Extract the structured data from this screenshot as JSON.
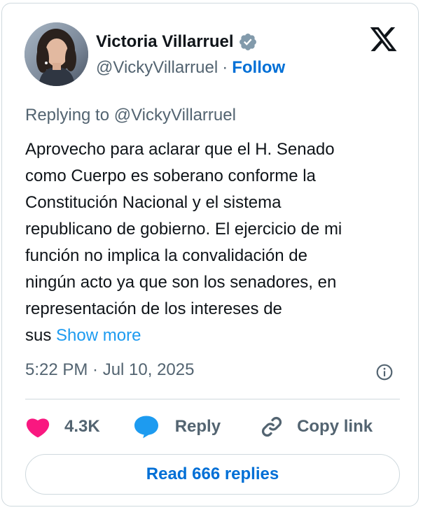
{
  "author": {
    "display_name": "Victoria Villarruel",
    "handle": "@VickyVillarruel",
    "separator": "·",
    "follow_label": "Follow",
    "verified": true,
    "verified_color": "#829aab"
  },
  "tweet": {
    "replying_to": "Replying to @VickyVillarruel",
    "text_lines": [
      "Aprovecho para aclarar que el H. Senado",
      "como Cuerpo es soberano conforme la",
      "Constitución Nacional y el sistema",
      "republicano de gobierno.  El ejercicio de mi",
      "función no implica la convalidación de",
      "ningún acto ya que son los senadores, en",
      "representación de los intereses de",
      "sus"
    ],
    "show_more_label": "Show more",
    "timestamp": "5:22 PM · Jul 10, 2025"
  },
  "actions": {
    "like_count": "4.3K",
    "reply_label": "Reply",
    "copy_link_label": "Copy link"
  },
  "read_replies_label": "Read 666 replies",
  "icons": {
    "platform_logo": "x-logo-icon",
    "like": "heart-icon",
    "reply": "speech-bubble-icon",
    "copy": "link-icon",
    "info": "info-icon",
    "verified": "verified-badge-icon"
  },
  "colors": {
    "accent": "#006fd6",
    "show_more": "#1d9bf0",
    "like": "#f91880",
    "reply_icon": "#1d9bf0",
    "secondary_text": "#536471",
    "border": "#cfd9de"
  }
}
